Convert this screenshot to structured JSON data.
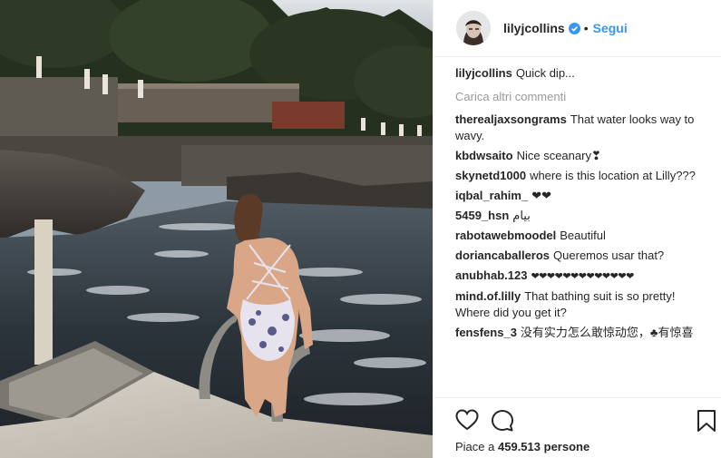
{
  "post": {
    "username": "lilyjcollins",
    "follow_label": "Segui",
    "separator": "•",
    "caption": "Quick dip...",
    "load_more": "Carica altri commenti",
    "likes_prefix": "Piace a",
    "likes_count": "459.513",
    "likes_suffix": "persone"
  },
  "comments": [
    {
      "user": "therealjaxsongrams",
      "text": "That water looks way to wavy."
    },
    {
      "user": "kbdwsaito",
      "text": "Nice sceanary❣"
    },
    {
      "user": "skynetd1000",
      "text": "where is this location at Lilly???"
    },
    {
      "user": "iqbal_rahim_",
      "text": "❤❤"
    },
    {
      "user": "5459_hsn",
      "text": "بيام"
    },
    {
      "user": "rabotawebmoodel",
      "text": "Beautiful"
    },
    {
      "user": "doriancaballeros",
      "text": "Queremos usar that?"
    },
    {
      "user": "anubhab.123",
      "text": "❤❤❤❤❤❤❤❤❤❤❤❤❤"
    },
    {
      "user": "mind.of.lilly",
      "text": "That bathing suit is so pretty! Where did you get it?"
    },
    {
      "user": "fensfens_3",
      "text": "没有实力怎么敢惊动您，♣有惊喜"
    }
  ],
  "icons": {
    "verified": "verified-badge-icon",
    "like": "heart-icon",
    "comment": "comment-bubble-icon",
    "save": "bookmark-icon"
  },
  "colors": {
    "link_blue": "#3897f0",
    "text": "#262626",
    "muted": "#999999",
    "border": "#efefef"
  }
}
